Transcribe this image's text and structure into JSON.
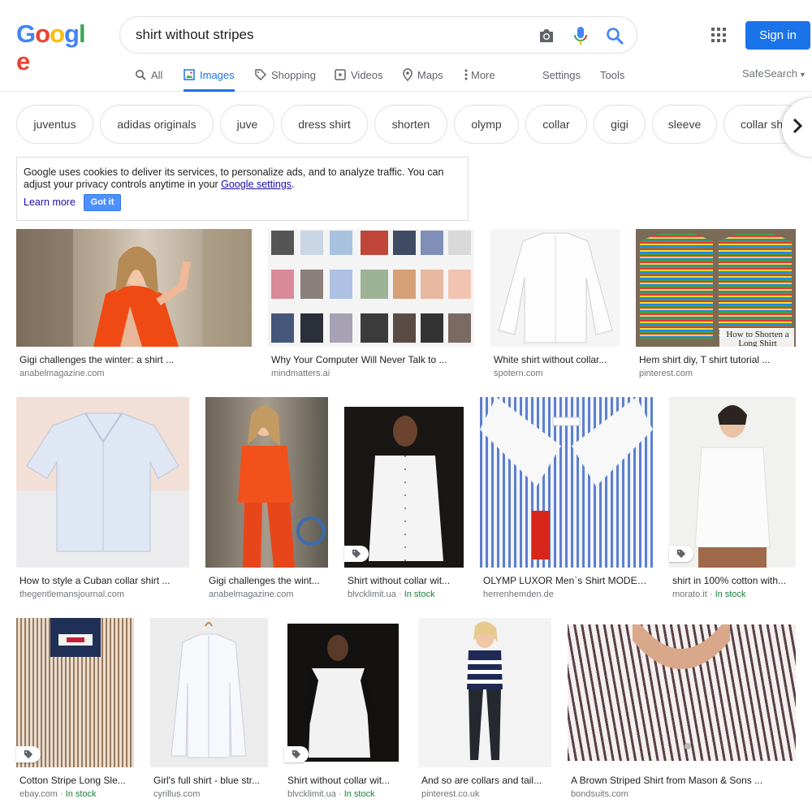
{
  "header": {
    "logo_letters": [
      "G",
      "o",
      "o",
      "g",
      "l",
      "e"
    ],
    "query": "shirt without stripes",
    "signin_label": "Sign in"
  },
  "tabs": [
    {
      "label": "All",
      "icon": "search-icon"
    },
    {
      "label": "Images",
      "icon": "images-icon"
    },
    {
      "label": "Shopping",
      "icon": "tag-icon"
    },
    {
      "label": "Videos",
      "icon": "play-icon"
    },
    {
      "label": "Maps",
      "icon": "map-pin-icon"
    },
    {
      "label": "More",
      "icon": "more-vert-icon"
    },
    {
      "label": "Settings"
    },
    {
      "label": "Tools"
    }
  ],
  "safesearch_label": "SafeSearch",
  "chips": [
    "juventus",
    "adidas originals",
    "juve",
    "dress shirt",
    "shorten",
    "olymp",
    "collar",
    "gigi",
    "sleeve",
    "collar sh"
  ],
  "cookie": {
    "text_before": "Google uses cookies to deliver its services, to personalize ads, and to analyze traffic. You can adjust your privacy controls anytime in your ",
    "link": "Google settings",
    "text_after": ".",
    "learn_more": "Learn more",
    "got_it": "Got it"
  },
  "results": [
    {
      "caption": "Gigi challenges the winter: a shirt ...",
      "source": "anabelmagazine.com",
      "stock": ""
    },
    {
      "caption": "Why Your Computer Will Never Talk to ...",
      "source": "mindmatters.ai",
      "stock": ""
    },
    {
      "caption": "White shirt without collar...",
      "source": "spotern.com",
      "stock": ""
    },
    {
      "caption": "Hem shirt diy, T shirt tutorial ...",
      "source": "pinterest.com",
      "stock": ""
    },
    {
      "caption": "How to style a Cuban collar shirt ...",
      "source": "thegentlemansjournal.com",
      "stock": ""
    },
    {
      "caption": "Gigi challenges the wint...",
      "source": "anabelmagazine.com",
      "stock": ""
    },
    {
      "caption": "Shirt without collar wit...",
      "source": "blvcklimit.ua",
      "stock": "In stock"
    },
    {
      "caption": "OLYMP LUXOR Men`s Shirt MODER...",
      "source": "herrenhemden.de",
      "stock": ""
    },
    {
      "caption": "shirt in 100% cotton with...",
      "source": "morato.it",
      "stock": "In stock"
    },
    {
      "caption": "Cotton Stripe Long Sle...",
      "source": "ebay.com",
      "stock": "In stock"
    },
    {
      "caption": "Girl's full shirt - blue str...",
      "source": "cyrillus.com",
      "stock": ""
    },
    {
      "caption": "Shirt without collar wit...",
      "source": "blvcklimit.ua",
      "stock": "In stock"
    },
    {
      "caption": "And so are collars and tail...",
      "source": "pinterest.co.uk",
      "stock": ""
    },
    {
      "caption": "A Brown Striped Shirt from Mason & Sons ...",
      "source": "bondsuits.com",
      "stock": ""
    }
  ],
  "thumb_overlay_text": "How to Shorten a Long Shirt",
  "colors": {
    "accent": "#1a73e8",
    "in_stock": "#188038"
  }
}
